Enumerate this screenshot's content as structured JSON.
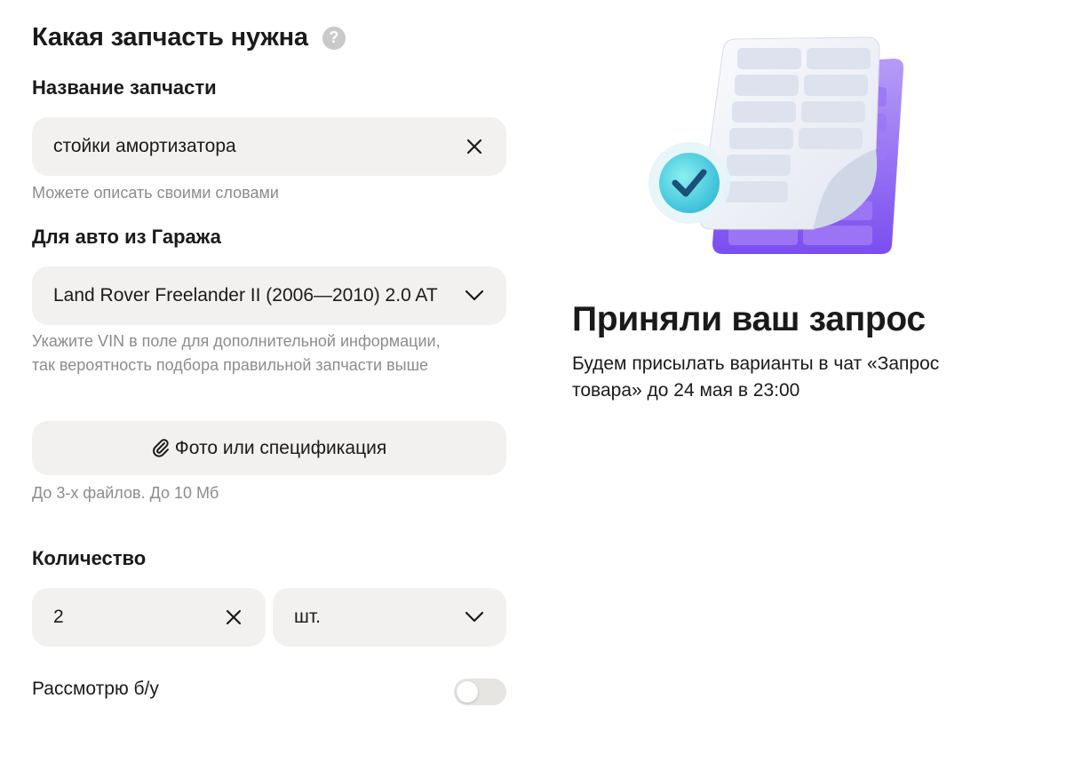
{
  "form": {
    "title": "Какая запчасть нужна",
    "help_icon": "?",
    "part_name": {
      "label": "Название запчасти",
      "value": "стойки амортизатора",
      "hint": "Можете описать своими словами"
    },
    "garage": {
      "label": "Для авто из Гаража",
      "value": "Land Rover Freelander II (2006—2010) 2.0 AT",
      "hint_line1": "Укажите VIN в поле для дополнительной информации,",
      "hint_line2": "так вероятность подбора правильной запчасти выше"
    },
    "attachment": {
      "label": "Фото или спецификация",
      "hint": "До 3-х файлов. До 10 Мб"
    },
    "quantity": {
      "label": "Количество",
      "value": "2",
      "unit": "шт."
    },
    "used": {
      "label": "Рассмотрю б/у",
      "enabled": false
    }
  },
  "confirmation": {
    "title": "Приняли ваш запрос",
    "text": "Будем присылать варианты в чат «Запрос товара» до 24 мая в 23:00"
  },
  "colors": {
    "field_bg": "#f2f1ef",
    "hint": "#8c8c8c",
    "accent_purple": "#8a5cf0",
    "check_teal": "#3fd0d8"
  }
}
